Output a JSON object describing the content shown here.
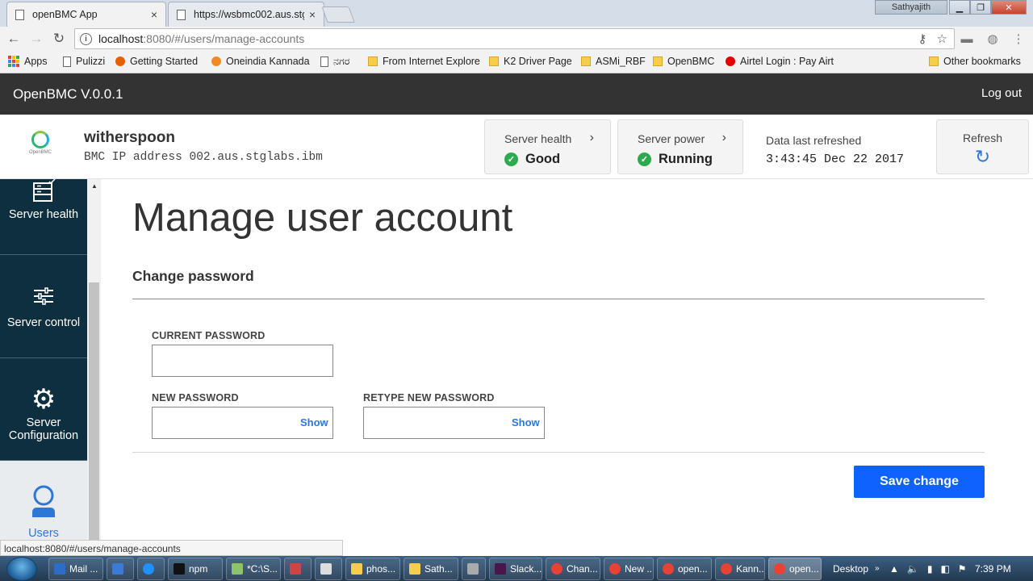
{
  "browser": {
    "tabs": [
      {
        "label": "openBMC App",
        "close": "×"
      },
      {
        "label": "https://wsbmc002.aus.stg",
        "close": "×"
      }
    ],
    "profile_name": "Sathyajith",
    "window_controls": {
      "minimize": "▁",
      "maximize": "❐",
      "close": "✕"
    },
    "url_host": "localhost",
    "url_path": ":8080/#/users/manage-accounts",
    "bookmarks": [
      {
        "label": "Apps",
        "icon": "apps-grid-icon"
      },
      {
        "label": "Pulizzi",
        "icon": "page-icon"
      },
      {
        "label": "Getting Started",
        "icon": "firefox-icon"
      },
      {
        "label": "Oneindia Kannada",
        "icon": "oneindia-icon"
      },
      {
        "label": "ನಗರ",
        "icon": "page-icon"
      },
      {
        "label": "From Internet Explore",
        "icon": "folder-icon"
      },
      {
        "label": "K2 Driver Page",
        "icon": "folder-icon"
      },
      {
        "label": "ASMi_RBF",
        "icon": "folder-icon"
      },
      {
        "label": "OpenBMC",
        "icon": "folder-icon"
      },
      {
        "label": "Airtel Login : Pay Airt",
        "icon": "airtel-icon"
      }
    ],
    "other_bookmarks": "Other bookmarks",
    "status_url": "localhost:8080/#/users/manage-accounts"
  },
  "app": {
    "brand": "OpenBMC V.0.0.1",
    "logout": "Log out"
  },
  "status": {
    "hostname": "witherspoon",
    "bmc_ip": "BMC IP address 002.aus.stglabs.ibm",
    "logo_text": "OpenBMC",
    "server_health_title": "Server health",
    "server_health_value": "Good",
    "server_power_title": "Server power",
    "server_power_value": "Running",
    "refreshed_label": "Data last refreshed",
    "refreshed_time": "3:43:45 Dec 22 2017",
    "refresh_label": "Refresh",
    "status_color": "#2eaa4e"
  },
  "nav": {
    "items": [
      {
        "label": "Server health",
        "icon": "server-health-icon"
      },
      {
        "label": "Server control",
        "icon": "sliders-icon"
      },
      {
        "label": "Server Configuration",
        "icon": "gear-icon"
      },
      {
        "label": "Users",
        "icon": "user-icon"
      }
    ]
  },
  "main": {
    "title": "Manage user account",
    "section": "Change password",
    "current_password_label": "CURRENT PASSWORD",
    "new_password_label": "NEW PASSWORD",
    "retype_password_label": "RETYPE NEW PASSWORD",
    "show_label": "Show",
    "save_label": "Save change",
    "accent_color": "#0f62fe"
  },
  "taskbar": {
    "items": [
      {
        "label": "Mail ..."
      },
      {
        "label": ""
      },
      {
        "label": ""
      },
      {
        "label": "npm"
      },
      {
        "label": "*C:\\S..."
      },
      {
        "label": ""
      },
      {
        "label": ""
      },
      {
        "label": "phos..."
      },
      {
        "label": "Sath..."
      },
      {
        "label": ""
      },
      {
        "label": "Slack..."
      },
      {
        "label": "Chan..."
      },
      {
        "label": "New ..."
      },
      {
        "label": "open..."
      },
      {
        "label": "Kann..."
      },
      {
        "label": "open..."
      }
    ],
    "desktop_label": "Desktop",
    "clock": "7:39 PM"
  }
}
